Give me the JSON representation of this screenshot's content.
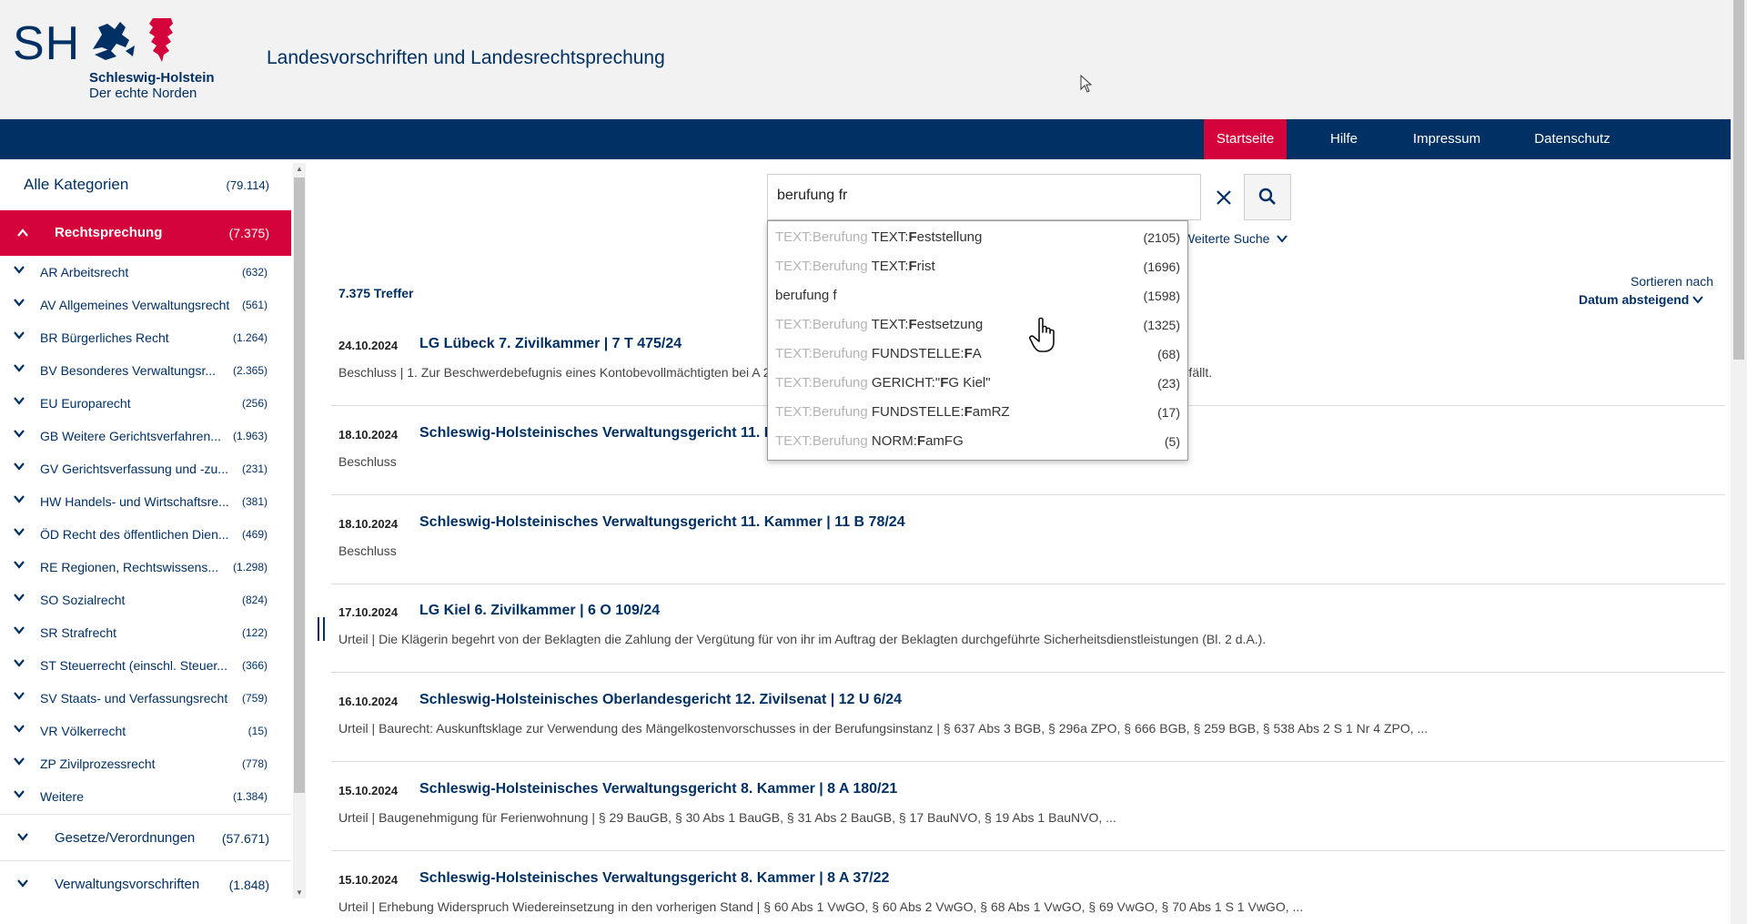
{
  "header": {
    "logo_sh": "SH",
    "logo_line1": "Schleswig-Holstein",
    "logo_line2": "Der echte Norden",
    "title": "Landesvorschriften und Landesrechtsprechung"
  },
  "nav": {
    "items": [
      "Startseite",
      "Hilfe",
      "Impressum",
      "Datenschutz"
    ],
    "active": "Startseite"
  },
  "sidebar": {
    "all": {
      "label": "Alle Kategorien",
      "count": "(79.114)"
    },
    "active": {
      "label": "Rechtsprechung",
      "count": "(7.375)"
    },
    "items": [
      {
        "label": "AR Arbeitsrecht",
        "count": "(632)"
      },
      {
        "label": "AV Allgemeines Verwaltungsrecht",
        "count": "(561)"
      },
      {
        "label": "BR Bürgerliches Recht",
        "count": "(1.264)"
      },
      {
        "label": "BV Besonderes Verwaltungsr...",
        "count": "(2.365)"
      },
      {
        "label": "EU Europarecht",
        "count": "(256)"
      },
      {
        "label": "GB Weitere Gerichtsverfahren...",
        "count": "(1.963)"
      },
      {
        "label": "GV Gerichtsverfassung und -zu...",
        "count": "(231)"
      },
      {
        "label": "HW Handels- und Wirtschaftsre...",
        "count": "(381)"
      },
      {
        "label": "ÖD Recht des öffentlichen Dien...",
        "count": "(469)"
      },
      {
        "label": "RE Regionen, Rechtswissens...",
        "count": "(1.298)"
      },
      {
        "label": "SO Sozialrecht",
        "count": "(824)"
      },
      {
        "label": "SR Strafrecht",
        "count": "(122)"
      },
      {
        "label": "ST Steuerrecht (einschl. Steuer...",
        "count": "(366)"
      },
      {
        "label": "SV Staats- und Verfassungsrecht",
        "count": "(759)"
      },
      {
        "label": "VR Völkerrecht",
        "count": "(15)"
      },
      {
        "label": "ZP Zivilprozessrecht",
        "count": "(778)"
      },
      {
        "label": "Weitere",
        "count": "(1.384)"
      }
    ],
    "sections": [
      {
        "label": "Gesetze/Verordnungen",
        "count": "(57.671)"
      },
      {
        "label": "Verwaltungsvorschriften",
        "count": "(1.848)"
      }
    ]
  },
  "search": {
    "value": "berufung fr",
    "advanced": "Weiterte Suche",
    "suggestions": [
      {
        "muted": "TEXT:Berufung ",
        "text": "TEXT:",
        "bold": "F",
        "rest": "eststellung",
        "count": "(2105)"
      },
      {
        "muted": "TEXT:Berufung ",
        "text": "TEXT:",
        "bold": "F",
        "rest": "rist",
        "count": "(1696)"
      },
      {
        "muted": "",
        "text": "berufung f",
        "bold": "",
        "rest": "",
        "count": "(1598)"
      },
      {
        "muted": "TEXT:Berufung ",
        "text": "TEXT:",
        "bold": "F",
        "rest": "estsetzung",
        "count": "(1325)"
      },
      {
        "muted": "TEXT:Berufung ",
        "text": "FUNDSTELLE:",
        "bold": "F",
        "rest": "A",
        "count": "(68)"
      },
      {
        "muted": "TEXT:Berufung ",
        "text": "GERICHT:\"",
        "bold": "F",
        "rest": "G Kiel\"",
        "count": "(23)"
      },
      {
        "muted": "TEXT:Berufung ",
        "text": "FUNDSTELLE:",
        "bold": "F",
        "rest": "amRZ",
        "count": "(17)"
      },
      {
        "muted": "TEXT:Berufung ",
        "text": "NORM:",
        "bold": "F",
        "rest": "amFG",
        "count": "(5)"
      }
    ]
  },
  "results": {
    "hits": "7.375 Treffer",
    "sort_label": "Sortieren nach",
    "sort_value": "Datum absteigend",
    "items": [
      {
        "date": "24.10.2024",
        "title": "LG Lübeck 7. Zivilkammer  |  7 T 475/24",
        "desc": "Beschluss | 1. Zur Beschwerdebefugnis eines Kontobevollmächtigten bei A                                                                                                                               2. Zur Frage, ob eine Kontovollmacht den Regelungen in § 1820 BGB unterfällt."
      },
      {
        "date": "18.10.2024",
        "title": "Schleswig-Holsteinisches Verwaltungsgericht 11. K",
        "desc": "Beschluss"
      },
      {
        "date": "18.10.2024",
        "title": "Schleswig-Holsteinisches Verwaltungsgericht 11. Kammer  |  11 B 78/24",
        "desc": "Beschluss"
      },
      {
        "date": "17.10.2024",
        "title": "LG Kiel 6. Zivilkammer  |  6 O 109/24",
        "desc": "Urteil | Die Klägerin begehrt von der Beklagten die Zahlung der Vergütung für von ihr im Auftrag der Beklagten durchgeführte Sicherheitsdienstleistungen (Bl. 2 d.A.)."
      },
      {
        "date": "16.10.2024",
        "title": "Schleswig-Holsteinisches Oberlandesgericht 12. Zivilsenat  |  12 U 6/24",
        "desc": "Urteil | Baurecht: Auskunftsklage zur Verwendung des Mängelkostenvorschusses in der Berufungsinstanz | § 637 Abs 3 BGB, § 296a ZPO, § 666 BGB, § 259 BGB, § 538 Abs 2 S 1 Nr 4 ZPO, ..."
      },
      {
        "date": "15.10.2024",
        "title": "Schleswig-Holsteinisches Verwaltungsgericht 8. Kammer  |  8 A 180/21",
        "desc": "Urteil | Baugenehmigung für Ferienwohnung | § 29 BauGB, § 30 Abs 1 BauGB, § 31 Abs 2 BauGB, § 17 BauNVO, § 19 Abs 1 BauNVO, ..."
      },
      {
        "date": "15.10.2024",
        "title": "Schleswig-Holsteinisches Verwaltungsgericht 8. Kammer  |  8 A 37/22",
        "desc": "Urteil | Erhebung Widerspruch Wiedereinsetzung in den vorherigen Stand | § 60 Abs 1 VwGO, § 60 Abs 2 VwGO, § 68 Abs 1 VwGO, § 69 VwGO, § 70 Abs 1 S 1 VwGO, ..."
      }
    ]
  },
  "colors": {
    "brand_blue": "#003064",
    "brand_red": "#d4033b"
  }
}
